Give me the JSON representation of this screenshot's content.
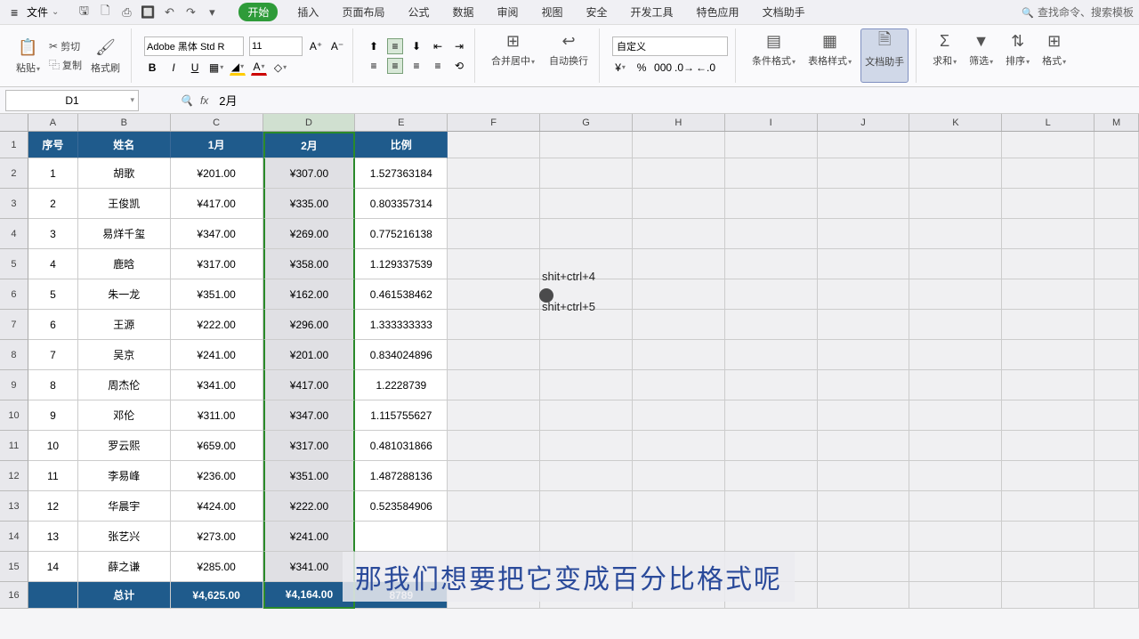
{
  "menu": {
    "file": "文件",
    "tabs": [
      "开始",
      "插入",
      "页面布局",
      "公式",
      "数据",
      "审阅",
      "视图",
      "安全",
      "开发工具",
      "特色应用",
      "文档助手"
    ],
    "search_placeholder": "查找命令、搜索模板"
  },
  "ribbon": {
    "paste": "粘贴",
    "cut": "剪切",
    "copy": "复制",
    "format_painter": "格式刷",
    "font_name": "Adobe 黑体 Std R",
    "font_size": "11",
    "merge": "合并居中",
    "wrap": "自动换行",
    "num_format": "自定义",
    "cond_fmt": "条件格式",
    "table_style": "表格样式",
    "doc_helper": "文档助手",
    "sum": "求和",
    "filter": "筛选",
    "sort": "排序",
    "format": "格式"
  },
  "formula_bar": {
    "name_box": "D1",
    "formula": "2月"
  },
  "cols": [
    "A",
    "B",
    "C",
    "D",
    "E",
    "F",
    "G",
    "H",
    "I",
    "J",
    "K",
    "L",
    "M"
  ],
  "headers": [
    "序号",
    "姓名",
    "1月",
    "2月",
    "比例"
  ],
  "data": [
    [
      "1",
      "胡歌",
      "¥201.00",
      "¥307.00",
      "1.527363184"
    ],
    [
      "2",
      "王俊凯",
      "¥417.00",
      "¥335.00",
      "0.803357314"
    ],
    [
      "3",
      "易烊千玺",
      "¥347.00",
      "¥269.00",
      "0.775216138"
    ],
    [
      "4",
      "鹿晗",
      "¥317.00",
      "¥358.00",
      "1.129337539"
    ],
    [
      "5",
      "朱一龙",
      "¥351.00",
      "¥162.00",
      "0.461538462"
    ],
    [
      "6",
      "王源",
      "¥222.00",
      "¥296.00",
      "1.333333333"
    ],
    [
      "7",
      "吴京",
      "¥241.00",
      "¥201.00",
      "0.834024896"
    ],
    [
      "8",
      "周杰伦",
      "¥341.00",
      "¥417.00",
      "1.2228739"
    ],
    [
      "9",
      "邓伦",
      "¥311.00",
      "¥347.00",
      "1.115755627"
    ],
    [
      "10",
      "罗云熙",
      "¥659.00",
      "¥317.00",
      "0.481031866"
    ],
    [
      "11",
      "李易峰",
      "¥236.00",
      "¥351.00",
      "1.487288136"
    ],
    [
      "12",
      "华晨宇",
      "¥424.00",
      "¥222.00",
      "0.523584906"
    ],
    [
      "13",
      "张艺兴",
      "¥273.00",
      "¥241.00",
      ""
    ],
    [
      "14",
      "薛之谦",
      "¥285.00",
      "¥341.00",
      ""
    ]
  ],
  "totals": [
    "",
    "总计",
    "¥4,625.00",
    "¥4,164.00",
    "8789"
  ],
  "notes": {
    "n1": "shit+ctrl+4",
    "n2": "shit+ctrl+5"
  },
  "subtitle": "那我们想要把它变成百分比格式呢"
}
